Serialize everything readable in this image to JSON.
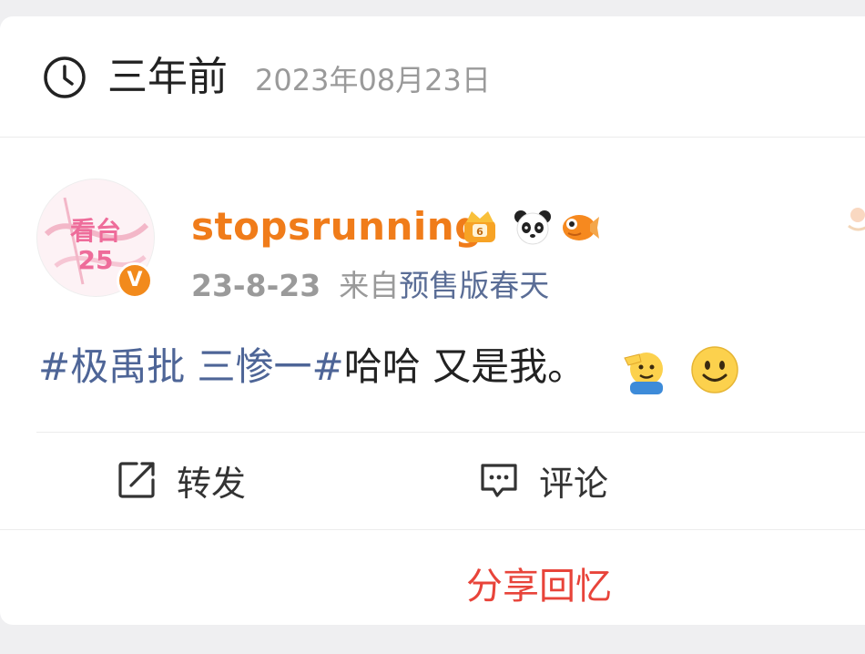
{
  "memory": {
    "time_ago": "三年前",
    "date": "2023年08月23日"
  },
  "post": {
    "username": "stopsrunning",
    "date": "23-8-23",
    "source_prefix": "来自",
    "source_app": "预售版春天",
    "hashtag": "#极禹批 三惨一#",
    "text": "哈哈 又是我。",
    "emojis": [
      "salute-emoji",
      "smile-emoji"
    ],
    "badges": [
      "crown-badge",
      "panda-badge",
      "goldfish-badge"
    ],
    "verified_mark": "V",
    "avatar_text_main": "看台",
    "avatar_text_num": "25"
  },
  "actions": {
    "repost_label": "转发",
    "comment_label": "评论"
  },
  "share": {
    "label": "分享回忆"
  },
  "colors": {
    "username": "#f07c1a",
    "hashtag": "#4e6597",
    "share": "#e8443a"
  }
}
